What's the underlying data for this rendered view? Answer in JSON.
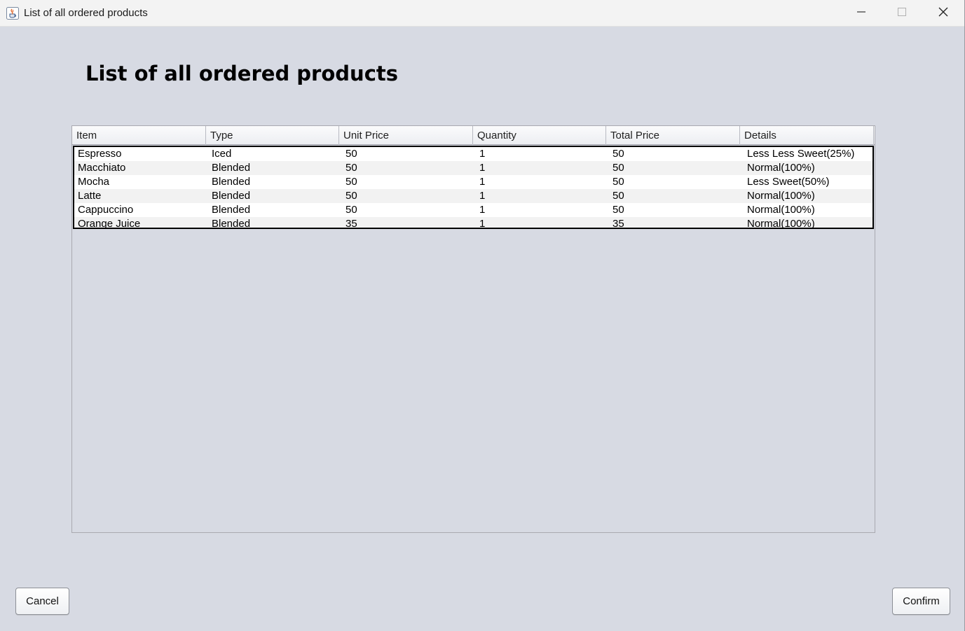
{
  "window": {
    "title": "List of all ordered products"
  },
  "heading": "List of all ordered products",
  "table": {
    "columns": [
      "Item",
      "Type",
      "Unit Price",
      "Quantity",
      "Total Price",
      "Details"
    ],
    "rows": [
      [
        "Espresso",
        "Iced",
        "50",
        "1",
        "50",
        "Less Less Sweet(25%)"
      ],
      [
        "Macchiato",
        "Blended",
        "50",
        "1",
        "50",
        "Normal(100%)"
      ],
      [
        "Mocha",
        "Blended",
        "50",
        "1",
        "50",
        "Less Sweet(50%)"
      ],
      [
        "Latte",
        "Blended",
        "50",
        "1",
        "50",
        "Normal(100%)"
      ],
      [
        "Cappuccino",
        "Blended",
        "50",
        "1",
        "50",
        "Normal(100%)"
      ],
      [
        "Orange Juice",
        "Blended",
        "35",
        "1",
        "35",
        "Normal(100%)"
      ]
    ]
  },
  "buttons": {
    "cancel": "Cancel",
    "confirm": "Confirm"
  },
  "icons": {
    "app": "java-cup-icon",
    "minimize": "minimize-icon",
    "maximize": "maximize-icon",
    "close": "close-icon"
  }
}
